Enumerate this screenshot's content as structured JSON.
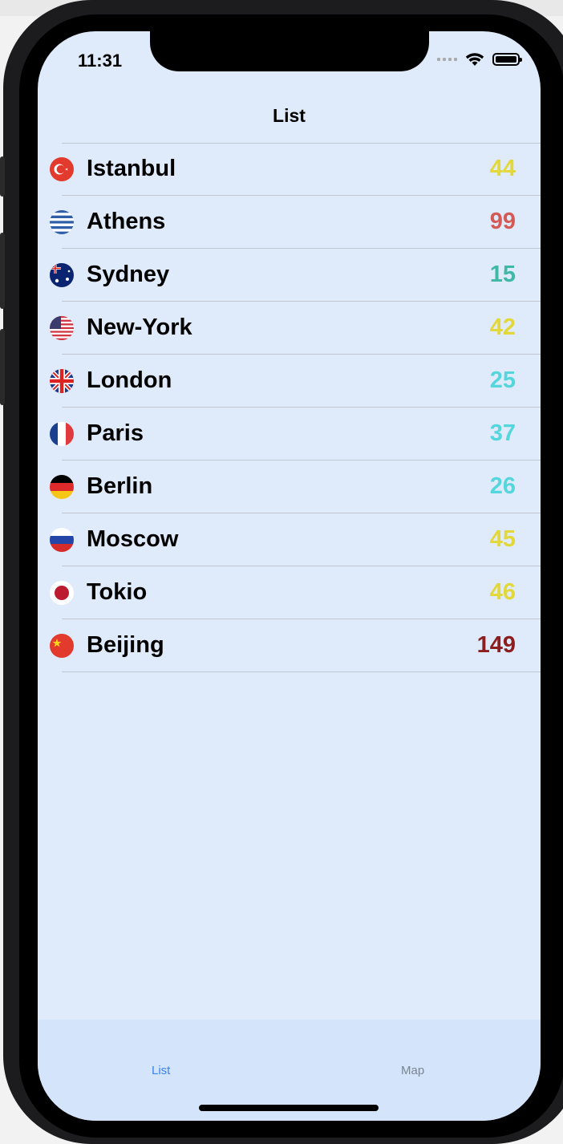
{
  "status": {
    "time": "11:31"
  },
  "nav": {
    "title": "List"
  },
  "cities": [
    {
      "name": "Istanbul",
      "value": "44",
      "value_color": "#e2d83a",
      "flag": "turkey-flag-icon"
    },
    {
      "name": "Athens",
      "value": "99",
      "value_color": "#d45b55",
      "flag": "greece-flag-icon"
    },
    {
      "name": "Sydney",
      "value": "15",
      "value_color": "#3fb8a8",
      "flag": "australia-flag-icon"
    },
    {
      "name": "New-York",
      "value": "42",
      "value_color": "#e2d83a",
      "flag": "usa-flag-icon"
    },
    {
      "name": "London",
      "value": "25",
      "value_color": "#54d6dc",
      "flag": "uk-flag-icon"
    },
    {
      "name": "Paris",
      "value": "37",
      "value_color": "#54d6dc",
      "flag": "france-flag-icon"
    },
    {
      "name": "Berlin",
      "value": "26",
      "value_color": "#54d6dc",
      "flag": "germany-flag-icon"
    },
    {
      "name": "Moscow",
      "value": "45",
      "value_color": "#e2d83a",
      "flag": "russia-flag-icon"
    },
    {
      "name": "Tokio",
      "value": "46",
      "value_color": "#e2d83a",
      "flag": "japan-flag-icon"
    },
    {
      "name": "Beijing",
      "value": "149",
      "value_color": "#8b1e1e",
      "flag": "china-flag-icon"
    }
  ],
  "tabs": [
    {
      "label": "List",
      "active": true
    },
    {
      "label": "Map",
      "active": false
    }
  ]
}
